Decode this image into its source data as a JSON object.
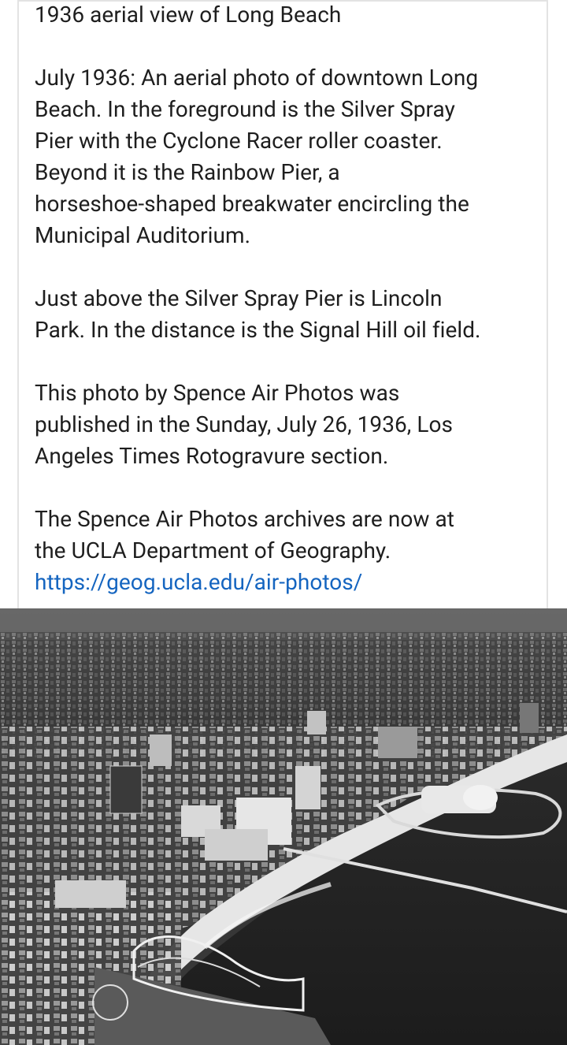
{
  "post": {
    "title": "1936 aerial view of Long Beach",
    "paragraphs": [
      "July 1936: An aerial photo of downtown Long\nBeach. In the foreground is the Silver Spray\nPier with the Cyclone Racer roller coaster.\nBeyond it is the Rainbow Pier, a\nhorseshoe-shaped breakwater encircling the\nMunicipal Auditorium.",
      "Just above the Silver Spray Pier is Lincoln\nPark. In the distance is the Signal Hill oil field.",
      "This photo by Spence Air Photos was\npublished in the Sunday, July 26, 1936, Los\nAngeles Times Rotogravure section."
    ],
    "archive_text": "The Spence Air Photos archives are now at\nthe UCLA Department of Geography.",
    "link_text": "https://geog.ucla.edu/air-photos/"
  },
  "colors": {
    "text": "#1e1e1e",
    "link": "#1565c0",
    "border": "#e3e3e3"
  }
}
